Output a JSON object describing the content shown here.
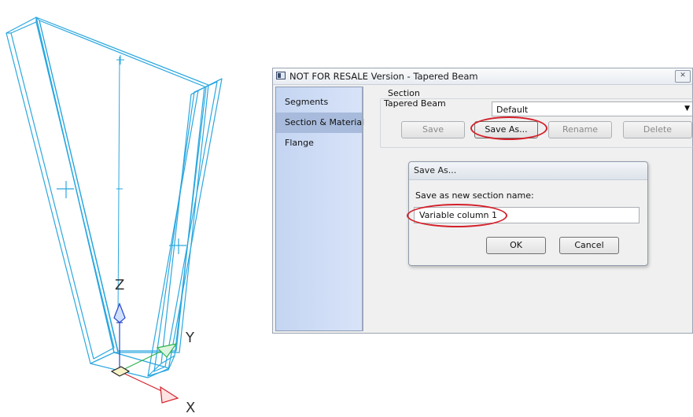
{
  "cad_view": {
    "axis_labels": {
      "x": "X",
      "y": "Y",
      "z": "Z"
    },
    "colors": {
      "wireframe": "#2aa7df",
      "z_axis": "#2746c9",
      "y_axis": "#2fb24a",
      "x_axis": "#d4202a"
    }
  },
  "window": {
    "title": "NOT FOR RESALE Version - Tapered Beam",
    "close_glyph": "✕"
  },
  "sidebar": {
    "items": [
      {
        "label": "Segments"
      },
      {
        "label": "Section & Material",
        "active": true
      },
      {
        "label": "Flange"
      }
    ]
  },
  "section_panel": {
    "group_title": "Section",
    "type_label": "Tapered Beam",
    "dropdown_value": "Default",
    "buttons": {
      "save": "Save",
      "save_as": "Save As...",
      "rename": "Rename",
      "delete": "Delete"
    }
  },
  "save_as_dialog": {
    "title": "Save As...",
    "prompt": "Save as new section name:",
    "input_value": "Variable column 1",
    "ok_label": "OK",
    "cancel_label": "Cancel"
  },
  "callout_color": "#d4202a"
}
